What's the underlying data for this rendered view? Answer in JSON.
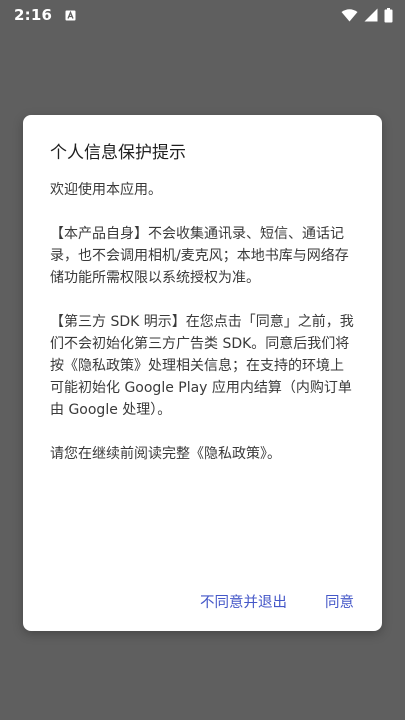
{
  "status_bar": {
    "time": "2:16",
    "notification_icon": "a-box-icon",
    "wifi_icon": "wifi-icon",
    "signal_icon": "signal-icon",
    "battery_icon": "battery-icon"
  },
  "dialog": {
    "title": "个人信息保护提示",
    "paragraphs": [
      "欢迎使用本应用。",
      "【本产品自身】不会收集通讯录、短信、通话记录，也不会调用相机/麦克风；本地书库与网络存储功能所需权限以系统授权为准。",
      "【第三方 SDK 明示】在您点击「同意」之前，我们不会初始化第三方广告类 SDK。同意后我们将按《隐私政策》处理相关信息；在支持的环境上可能初始化 Google Play 应用内结算（内购订单由 Google 处理）。",
      "请您在继续前阅读完整《隐私政策》。"
    ],
    "buttons": {
      "decline": "不同意并退出",
      "agree": "同意"
    }
  },
  "colors": {
    "scrim": "#5f5f5f",
    "dialog_bg": "#ffffff",
    "accent": "#4457c8"
  }
}
